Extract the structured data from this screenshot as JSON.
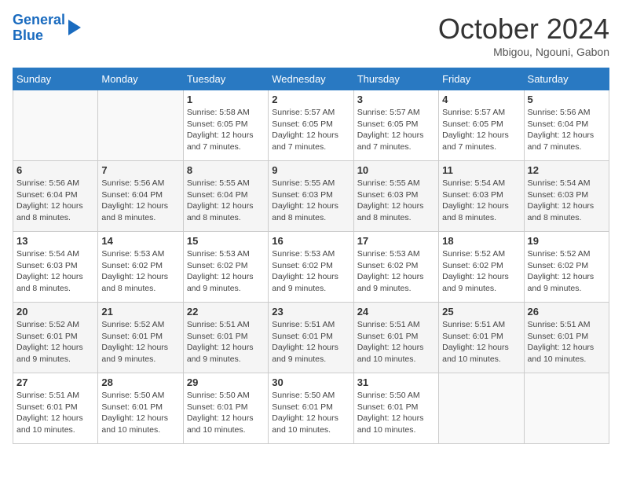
{
  "logo": {
    "line1": "General",
    "line2": "Blue"
  },
  "title": "October 2024",
  "subtitle": "Mbigou, Ngouni, Gabon",
  "days_of_week": [
    "Sunday",
    "Monday",
    "Tuesday",
    "Wednesday",
    "Thursday",
    "Friday",
    "Saturday"
  ],
  "weeks": [
    [
      {
        "day": "",
        "detail": ""
      },
      {
        "day": "",
        "detail": ""
      },
      {
        "day": "1",
        "detail": "Sunrise: 5:58 AM\nSunset: 6:05 PM\nDaylight: 12 hours and 7 minutes."
      },
      {
        "day": "2",
        "detail": "Sunrise: 5:57 AM\nSunset: 6:05 PM\nDaylight: 12 hours and 7 minutes."
      },
      {
        "day": "3",
        "detail": "Sunrise: 5:57 AM\nSunset: 6:05 PM\nDaylight: 12 hours and 7 minutes."
      },
      {
        "day": "4",
        "detail": "Sunrise: 5:57 AM\nSunset: 6:05 PM\nDaylight: 12 hours and 7 minutes."
      },
      {
        "day": "5",
        "detail": "Sunrise: 5:56 AM\nSunset: 6:04 PM\nDaylight: 12 hours and 7 minutes."
      }
    ],
    [
      {
        "day": "6",
        "detail": "Sunrise: 5:56 AM\nSunset: 6:04 PM\nDaylight: 12 hours and 8 minutes."
      },
      {
        "day": "7",
        "detail": "Sunrise: 5:56 AM\nSunset: 6:04 PM\nDaylight: 12 hours and 8 minutes."
      },
      {
        "day": "8",
        "detail": "Sunrise: 5:55 AM\nSunset: 6:04 PM\nDaylight: 12 hours and 8 minutes."
      },
      {
        "day": "9",
        "detail": "Sunrise: 5:55 AM\nSunset: 6:03 PM\nDaylight: 12 hours and 8 minutes."
      },
      {
        "day": "10",
        "detail": "Sunrise: 5:55 AM\nSunset: 6:03 PM\nDaylight: 12 hours and 8 minutes."
      },
      {
        "day": "11",
        "detail": "Sunrise: 5:54 AM\nSunset: 6:03 PM\nDaylight: 12 hours and 8 minutes."
      },
      {
        "day": "12",
        "detail": "Sunrise: 5:54 AM\nSunset: 6:03 PM\nDaylight: 12 hours and 8 minutes."
      }
    ],
    [
      {
        "day": "13",
        "detail": "Sunrise: 5:54 AM\nSunset: 6:03 PM\nDaylight: 12 hours and 8 minutes."
      },
      {
        "day": "14",
        "detail": "Sunrise: 5:53 AM\nSunset: 6:02 PM\nDaylight: 12 hours and 8 minutes."
      },
      {
        "day": "15",
        "detail": "Sunrise: 5:53 AM\nSunset: 6:02 PM\nDaylight: 12 hours and 9 minutes."
      },
      {
        "day": "16",
        "detail": "Sunrise: 5:53 AM\nSunset: 6:02 PM\nDaylight: 12 hours and 9 minutes."
      },
      {
        "day": "17",
        "detail": "Sunrise: 5:53 AM\nSunset: 6:02 PM\nDaylight: 12 hours and 9 minutes."
      },
      {
        "day": "18",
        "detail": "Sunrise: 5:52 AM\nSunset: 6:02 PM\nDaylight: 12 hours and 9 minutes."
      },
      {
        "day": "19",
        "detail": "Sunrise: 5:52 AM\nSunset: 6:02 PM\nDaylight: 12 hours and 9 minutes."
      }
    ],
    [
      {
        "day": "20",
        "detail": "Sunrise: 5:52 AM\nSunset: 6:01 PM\nDaylight: 12 hours and 9 minutes."
      },
      {
        "day": "21",
        "detail": "Sunrise: 5:52 AM\nSunset: 6:01 PM\nDaylight: 12 hours and 9 minutes."
      },
      {
        "day": "22",
        "detail": "Sunrise: 5:51 AM\nSunset: 6:01 PM\nDaylight: 12 hours and 9 minutes."
      },
      {
        "day": "23",
        "detail": "Sunrise: 5:51 AM\nSunset: 6:01 PM\nDaylight: 12 hours and 9 minutes."
      },
      {
        "day": "24",
        "detail": "Sunrise: 5:51 AM\nSunset: 6:01 PM\nDaylight: 12 hours and 10 minutes."
      },
      {
        "day": "25",
        "detail": "Sunrise: 5:51 AM\nSunset: 6:01 PM\nDaylight: 12 hours and 10 minutes."
      },
      {
        "day": "26",
        "detail": "Sunrise: 5:51 AM\nSunset: 6:01 PM\nDaylight: 12 hours and 10 minutes."
      }
    ],
    [
      {
        "day": "27",
        "detail": "Sunrise: 5:51 AM\nSunset: 6:01 PM\nDaylight: 12 hours and 10 minutes."
      },
      {
        "day": "28",
        "detail": "Sunrise: 5:50 AM\nSunset: 6:01 PM\nDaylight: 12 hours and 10 minutes."
      },
      {
        "day": "29",
        "detail": "Sunrise: 5:50 AM\nSunset: 6:01 PM\nDaylight: 12 hours and 10 minutes."
      },
      {
        "day": "30",
        "detail": "Sunrise: 5:50 AM\nSunset: 6:01 PM\nDaylight: 12 hours and 10 minutes."
      },
      {
        "day": "31",
        "detail": "Sunrise: 5:50 AM\nSunset: 6:01 PM\nDaylight: 12 hours and 10 minutes."
      },
      {
        "day": "",
        "detail": ""
      },
      {
        "day": "",
        "detail": ""
      }
    ]
  ]
}
